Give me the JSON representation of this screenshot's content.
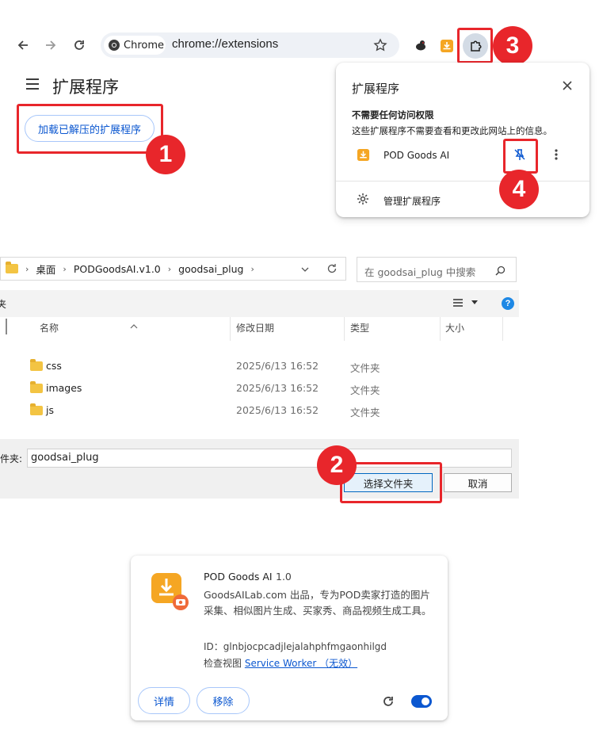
{
  "browser": {
    "chip_label": "Chrome",
    "url": "chrome://extensions"
  },
  "page": {
    "title": "扩展程序",
    "load_unpacked_label": "加载已解压的扩展程序"
  },
  "markers": [
    "1",
    "2",
    "3",
    "4"
  ],
  "popup": {
    "title": "扩展程序",
    "section_heading": "不需要任何访问权限",
    "section_desc": "这些扩展程序不需要查看和更改此网站上的信息。",
    "extension_name": "POD Goods AI",
    "manage_label": "管理扩展程序"
  },
  "file_dialog": {
    "breadcrumbs": [
      "桌面",
      "PODGoodsAI.v1.0",
      "goodsai_plug"
    ],
    "search_placeholder": "在 goodsai_plug 中搜索",
    "left_cut_label": "夹",
    "columns": {
      "name": "名称",
      "modified": "修改日期",
      "type": "类型",
      "size": "大小"
    },
    "rows": [
      {
        "name": "css",
        "modified": "2025/6/13 16:52",
        "type": "文件夹"
      },
      {
        "name": "images",
        "modified": "2025/6/13 16:52",
        "type": "文件夹"
      },
      {
        "name": "js",
        "modified": "2025/6/13 16:52",
        "type": "文件夹"
      }
    ],
    "folder_label": "文件夹:",
    "folder_value": "goodsai_plug",
    "select_button": "选择文件夹",
    "cancel_button": "取消"
  },
  "ext_card": {
    "name": "POD Goods AI",
    "version": "1.0",
    "description": "GoodsAILab.com 出品，专为POD卖家打造的图片采集、相似图片生成、买家秀、商品视频生成工具。",
    "id_line": "ID：glnbjocpcadjlejalahphfmgaonhilgd",
    "inspect_prefix": "检查视图",
    "inspect_link": "Service Worker （无效）",
    "details_button": "详情",
    "remove_button": "移除",
    "enabled": true
  },
  "colors": {
    "highlight": "#e8262b",
    "accent": "#0b57d0",
    "extension_icon": "#f5a623"
  }
}
